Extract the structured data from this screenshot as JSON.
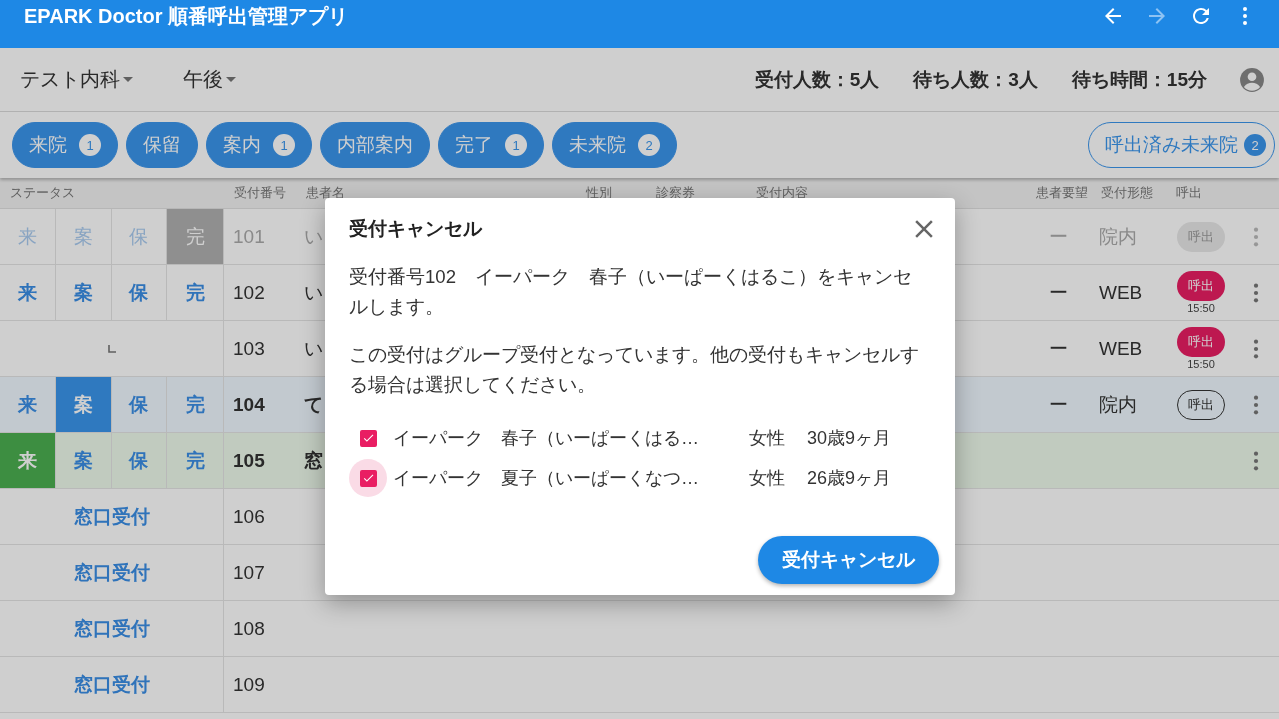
{
  "app_bar": {
    "title": "EPARK Doctor 順番呼出管理アプリ",
    "nav": [
      {
        "kind": "back",
        "disabled": false
      },
      {
        "kind": "forward",
        "disabled": true
      },
      {
        "kind": "refresh",
        "disabled": false
      },
      {
        "kind": "menu",
        "disabled": false
      }
    ]
  },
  "toolbar": {
    "dropdowns": [
      "テスト内科",
      "午後"
    ],
    "stats": [
      "受付人数：5人",
      "待ち人数：3人",
      "待ち時間：15分"
    ]
  },
  "filters": [
    {
      "label": "来院",
      "count": "1",
      "kind": "filled"
    },
    {
      "label": "保留",
      "kind": "filled"
    },
    {
      "label": "案内",
      "count": "1",
      "kind": "filled"
    },
    {
      "label": "内部案内",
      "kind": "filled"
    },
    {
      "label": "完了",
      "count": "1",
      "kind": "filled"
    },
    {
      "label": "未来院",
      "count": "2",
      "kind": "filled"
    },
    {
      "label": "呼出済み未来院",
      "count": "2",
      "kind": "outline"
    }
  ],
  "table": {
    "columns": [
      "ステータス",
      "受付番号",
      "患者名",
      "性別",
      "診察券",
      "受付内容",
      "患者要望",
      "受付形態",
      "呼出"
    ],
    "rows": [
      {
        "kind": "buttons",
        "emphasized": false,
        "status_buttons": [
          {
            "label": "来",
            "selected": false
          },
          {
            "label": "案",
            "selected": false
          },
          {
            "label": "保",
            "selected": false
          },
          {
            "label": "完",
            "selected": true
          }
        ],
        "number": "101",
        "name": "い",
        "request": "ー",
        "channel": "院内",
        "call": {
          "kind": "disabled",
          "label": "呼出"
        }
      },
      {
        "kind": "buttons",
        "emphasized": false,
        "status_buttons": [
          {
            "label": "来",
            "selected": false
          },
          {
            "label": "案",
            "selected": false
          },
          {
            "label": "保",
            "selected": false
          },
          {
            "label": "完",
            "selected": false
          }
        ],
        "number": "102",
        "name": "い",
        "request": "ー",
        "channel": "WEB",
        "call": {
          "kind": "called",
          "label": "呼出",
          "time": "15:50"
        }
      },
      {
        "kind": "child",
        "emphasized": false,
        "number": "103",
        "name": "い",
        "request": "ー",
        "channel": "WEB",
        "call": {
          "kind": "called",
          "label": "呼出",
          "time": "15:50"
        }
      },
      {
        "kind": "buttons",
        "emphasized": true,
        "status_buttons": [
          {
            "label": "来",
            "selected": false
          },
          {
            "label": "案",
            "selected": true
          },
          {
            "label": "保",
            "selected": false
          },
          {
            "label": "完",
            "selected": false
          }
        ],
        "number": "104",
        "name": "て",
        "request": "ー",
        "channel": "院内",
        "call": {
          "kind": "outline",
          "label": "呼出"
        }
      },
      {
        "kind": "buttons",
        "emphasized": true,
        "status_buttons": [
          {
            "label": "来",
            "selected": true
          },
          {
            "label": "案",
            "selected": false
          },
          {
            "label": "保",
            "selected": false
          },
          {
            "label": "完",
            "selected": false
          }
        ],
        "number": "105",
        "name": "窓"
      },
      {
        "kind": "walkin",
        "walkin_label": "窓口受付",
        "number": "106"
      },
      {
        "kind": "walkin",
        "walkin_label": "窓口受付",
        "number": "107"
      },
      {
        "kind": "walkin",
        "walkin_label": "窓口受付",
        "number": "108"
      },
      {
        "kind": "walkin",
        "walkin_label": "窓口受付",
        "number": "109"
      }
    ]
  },
  "dialog": {
    "title": "受付キャンセル",
    "paragraphs": [
      "受付番号102　イーパーク　春子（いーぱーくはるこ）をキャンセルします。",
      "この受付はグループ受付となっています。他の受付もキャンセルする場合は選択してください。"
    ],
    "members": [
      {
        "name": "イーパーク　春子（いーぱーくはる…",
        "sex": "女性",
        "age": "30歳9ヶ月",
        "checked": true,
        "focused": false
      },
      {
        "name": "イーパーク　夏子（いーぱーくなつ…",
        "sex": "女性",
        "age": "26歳9ヶ月",
        "checked": true,
        "focused": true
      }
    ],
    "confirm": "受付キャンセル"
  }
}
